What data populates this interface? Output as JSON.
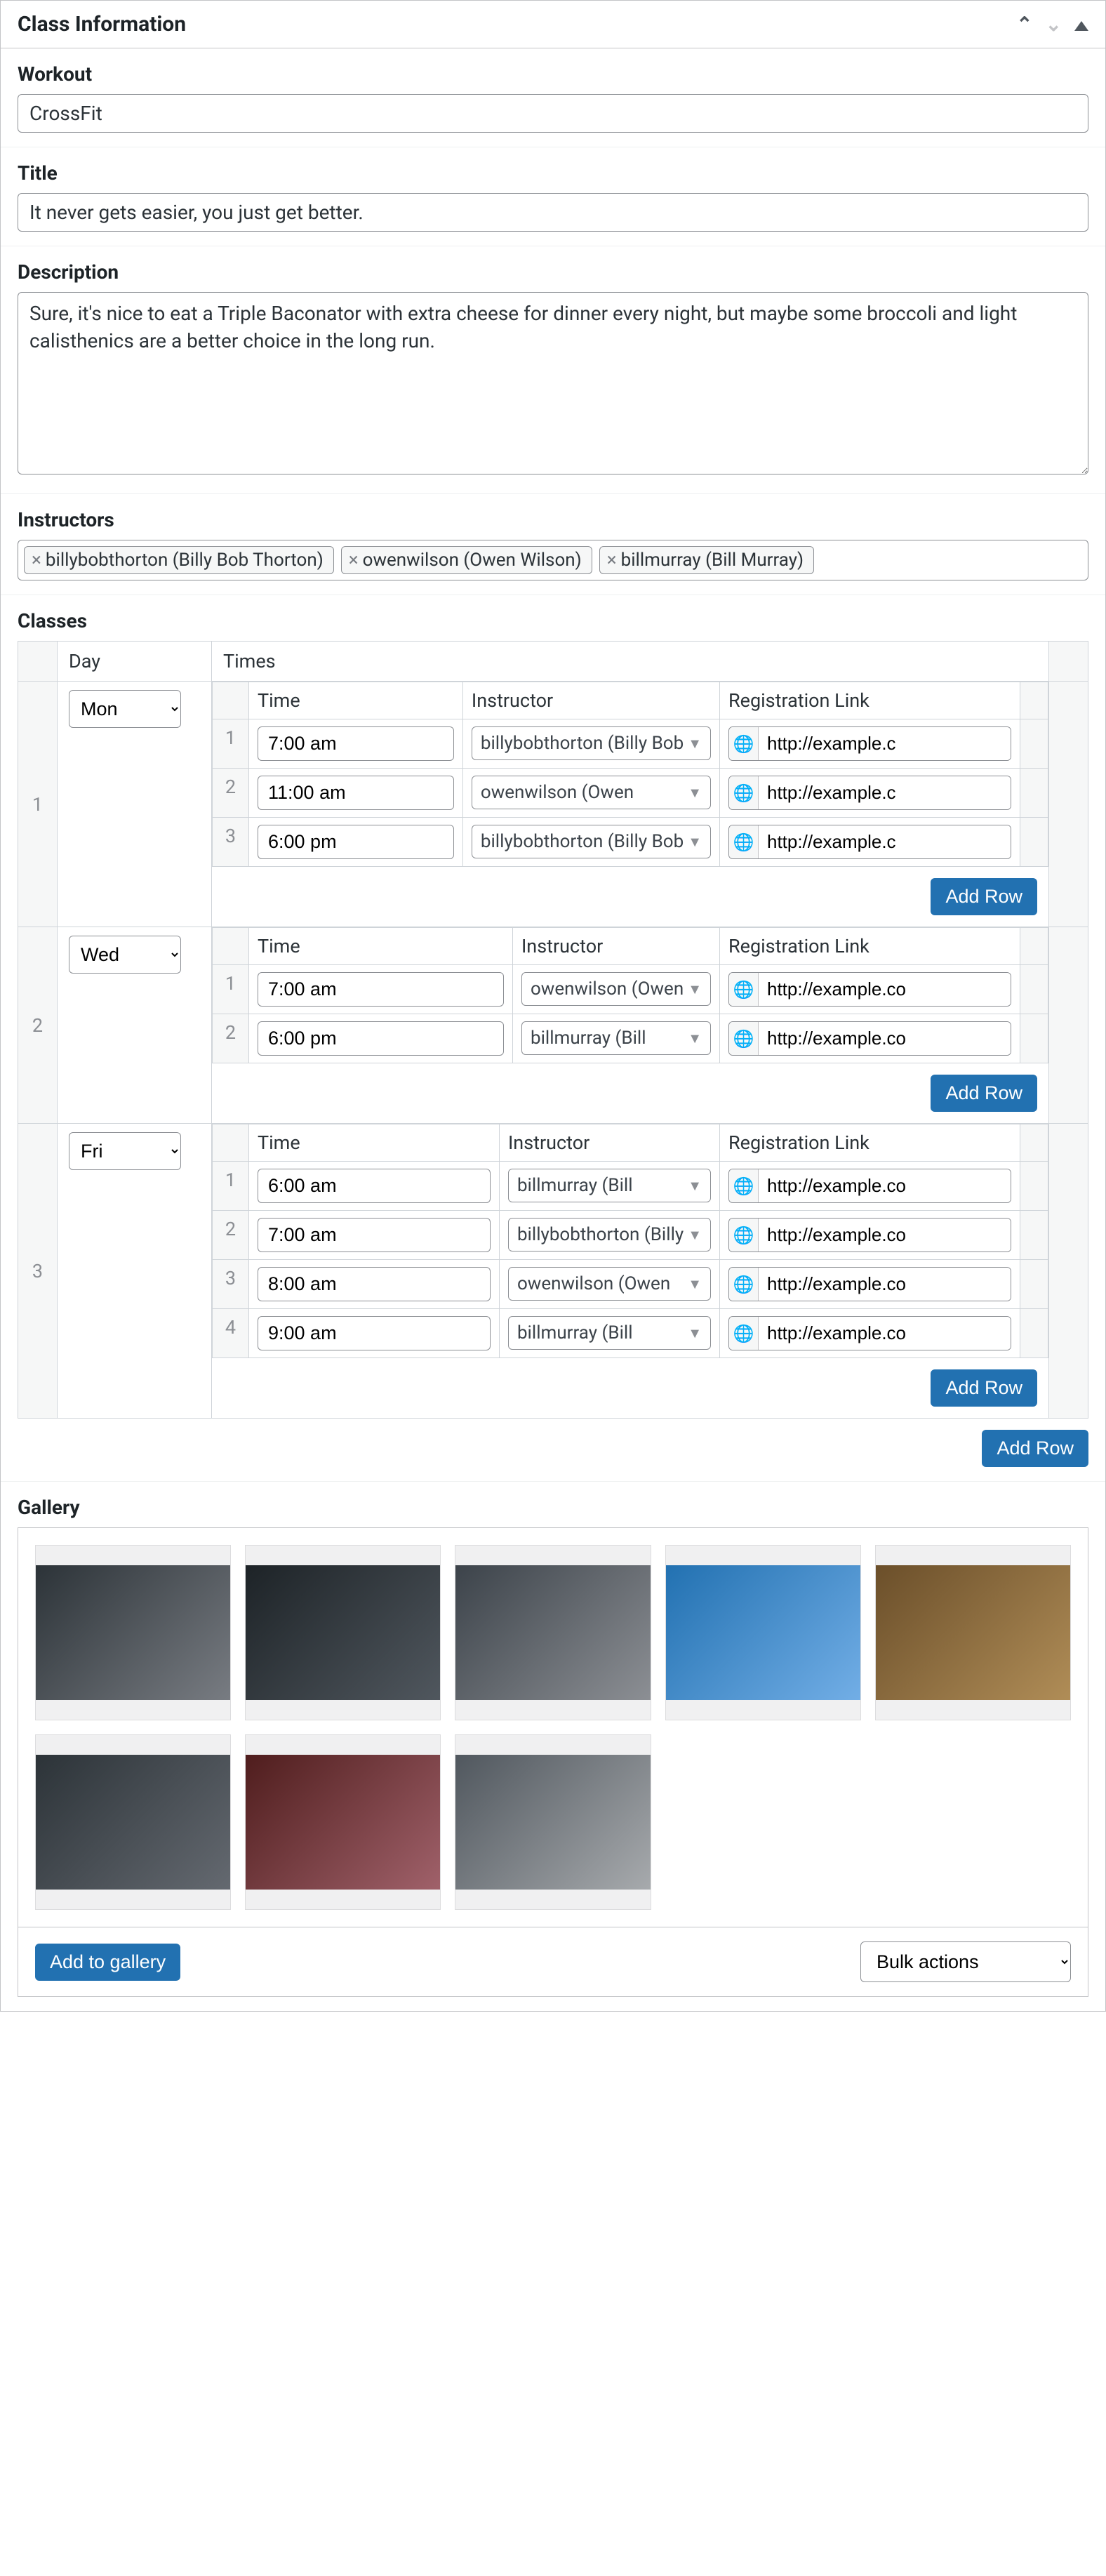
{
  "panel": {
    "title": "Class Information"
  },
  "workout": {
    "label": "Workout",
    "value": "CrossFit"
  },
  "title": {
    "label": "Title",
    "value": "It never gets easier, you just get better."
  },
  "description": {
    "label": "Description",
    "value": "Sure, it's nice to eat a Triple Baconator with extra cheese for dinner every night, but maybe some broccoli and light calisthenics are a better choice in the long run."
  },
  "instructors": {
    "label": "Instructors",
    "tags": [
      "billybobthorton (Billy Bob Thorton)",
      "owenwilson (Owen Wilson)",
      "billmurray (Bill Murray)"
    ]
  },
  "classes": {
    "label": "Classes",
    "cols": {
      "day": "Day",
      "times": "Times"
    },
    "inner_cols": {
      "time": "Time",
      "instructor": "Instructor",
      "reg": "Registration Link"
    },
    "add_row": "Add Row",
    "rows": [
      {
        "num": "1",
        "day": "Mon",
        "times": [
          {
            "n": "1",
            "time": "7:00 am",
            "instructor": "billybobthorton (Billy Bob",
            "reg": "http://example.c"
          },
          {
            "n": "2",
            "time": "11:00 am",
            "instructor": "owenwilson (Owen",
            "reg": "http://example.c"
          },
          {
            "n": "3",
            "time": "6:00 pm",
            "instructor": "billybobthorton (Billy Bob",
            "reg": "http://example.c"
          }
        ]
      },
      {
        "num": "2",
        "day": "Wed",
        "times": [
          {
            "n": "1",
            "time": "7:00 am",
            "instructor": "owenwilson (Owen",
            "reg": "http://example.co"
          },
          {
            "n": "2",
            "time": "6:00 pm",
            "instructor": "billmurray (Bill",
            "reg": "http://example.co"
          }
        ]
      },
      {
        "num": "3",
        "day": "Fri",
        "times": [
          {
            "n": "1",
            "time": "6:00 am",
            "instructor": "billmurray (Bill",
            "reg": "http://example.co"
          },
          {
            "n": "2",
            "time": "7:00 am",
            "instructor": "billybobthorton (Billy",
            "reg": "http://example.co"
          },
          {
            "n": "3",
            "time": "8:00 am",
            "instructor": "owenwilson (Owen",
            "reg": "http://example.co"
          },
          {
            "n": "4",
            "time": "9:00 am",
            "instructor": "billmurray (Bill",
            "reg": "http://example.co"
          }
        ]
      }
    ]
  },
  "gallery": {
    "label": "Gallery",
    "add_btn": "Add to gallery",
    "bulk": "Bulk actions",
    "count": 8
  }
}
